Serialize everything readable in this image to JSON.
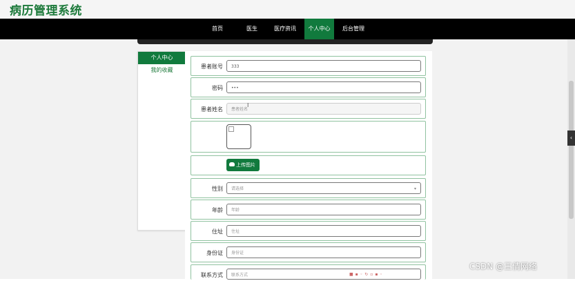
{
  "app": {
    "title": "病历管理系统"
  },
  "nav": {
    "items": [
      {
        "label": "首页",
        "active": false
      },
      {
        "label": "医生",
        "active": false
      },
      {
        "label": "医疗资讯",
        "active": false
      },
      {
        "label": "个人中心",
        "active": true
      },
      {
        "label": "后台管理",
        "active": false
      }
    ]
  },
  "sidebar": {
    "items": [
      {
        "label": "个人中心",
        "active": true
      },
      {
        "label": "我的收藏",
        "active": false
      }
    ]
  },
  "form": {
    "account": {
      "label": "患者账号",
      "value": "333"
    },
    "password": {
      "label": "密码",
      "value": "•••"
    },
    "name": {
      "label": "患者姓名",
      "placeholder": "患者姓名"
    },
    "upload": {
      "label": "上传图片"
    },
    "gender": {
      "label": "性别",
      "placeholder": "请选择"
    },
    "age": {
      "label": "年龄",
      "placeholder": "年龄"
    },
    "address": {
      "label": "住址",
      "placeholder": "住址"
    },
    "id_card": {
      "label": "身份证",
      "placeholder": "身份证"
    },
    "contact": {
      "label": "联系方式",
      "placeholder": "联系方式"
    }
  },
  "watermark": "CSDN @王倩网络",
  "colors": {
    "brand_green": "#117a3d",
    "title_green": "#1d7a3b",
    "nav_black": "#000000"
  }
}
